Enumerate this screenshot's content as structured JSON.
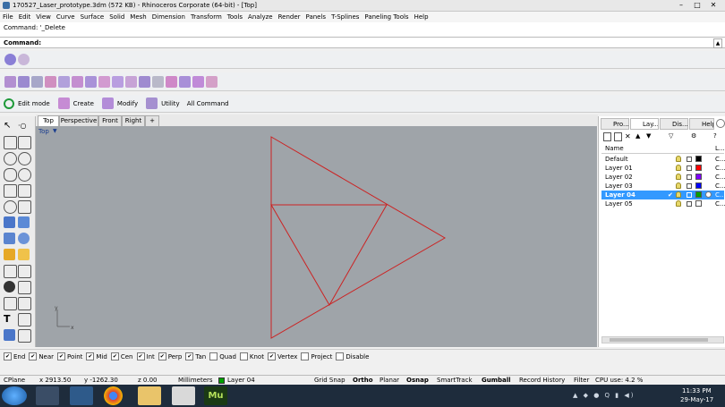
{
  "window": {
    "title": "170527_Laser_prototype.3dm (572 KB) - Rhinoceros Corporate (64-bit) - [Top]"
  },
  "menu": [
    "File",
    "Edit",
    "View",
    "Curve",
    "Surface",
    "Solid",
    "Mesh",
    "Dimension",
    "Transform",
    "Tools",
    "Analyze",
    "Render",
    "Panels",
    "T-Splines",
    "Paneling Tools",
    "Help"
  ],
  "command": {
    "history": "Command: '_Delete",
    "prompt": "Command:"
  },
  "toolbar": {
    "edit_mode": "Edit mode",
    "create": "Create",
    "modify": "Modify",
    "utility": "Utility",
    "all_command": "All Command"
  },
  "viewport": {
    "tabs": [
      "Top",
      "Perspective",
      "Front",
      "Right"
    ],
    "add_tab": "+",
    "active_label": "Top",
    "axis_y": "y",
    "axis_x": "x"
  },
  "layers_panel": {
    "tabs": [
      "Pro...",
      "Lay...",
      "Dis...",
      "Help"
    ],
    "header_name": "Name",
    "header_l": "L...",
    "layers": [
      {
        "name": "Default",
        "color": "#000000",
        "lt": "C..."
      },
      {
        "name": "Layer 01",
        "color": "#ff0000",
        "lt": "C..."
      },
      {
        "name": "Layer 02",
        "color": "#8000ff",
        "lt": "C..."
      },
      {
        "name": "Layer 03",
        "color": "#0000ff",
        "lt": "C..."
      },
      {
        "name": "Layer 04",
        "color": "#00a000",
        "lt": "C...",
        "selected": true,
        "current": "✔"
      },
      {
        "name": "Layer 05",
        "color": "#ffffff",
        "lt": "C..."
      }
    ]
  },
  "osnap": [
    {
      "label": "End",
      "checked": true
    },
    {
      "label": "Near",
      "checked": true
    },
    {
      "label": "Point",
      "checked": true
    },
    {
      "label": "Mid",
      "checked": true
    },
    {
      "label": "Cen",
      "checked": true
    },
    {
      "label": "Int",
      "checked": true
    },
    {
      "label": "Perp",
      "checked": true
    },
    {
      "label": "Tan",
      "checked": true
    },
    {
      "label": "Quad",
      "checked": false
    },
    {
      "label": "Knot",
      "checked": false
    },
    {
      "label": "Vertex",
      "checked": true
    },
    {
      "label": "Project",
      "checked": false
    },
    {
      "label": "Disable",
      "checked": false
    }
  ],
  "status": {
    "cplane": "CPlane",
    "x": "x 2913.50",
    "y": "y -1262.30",
    "z": "z 0.00",
    "units": "Millimeters",
    "layer": "Layer 04",
    "grid_snap": "Grid Snap",
    "ortho": "Ortho",
    "planar": "Planar",
    "osnap": "Osnap",
    "smarttrack": "SmartTrack",
    "gumball": "Gumball",
    "record_history": "Record History",
    "filter": "Filter",
    "cpu": "CPU use: 4.2 %"
  },
  "taskbar": {
    "time": "11:33 PM",
    "date": "29-May-17"
  },
  "colors": {
    "curve": "#cc2222",
    "viewport_bg": "#9fa4a9",
    "selection": "#3399ff"
  }
}
